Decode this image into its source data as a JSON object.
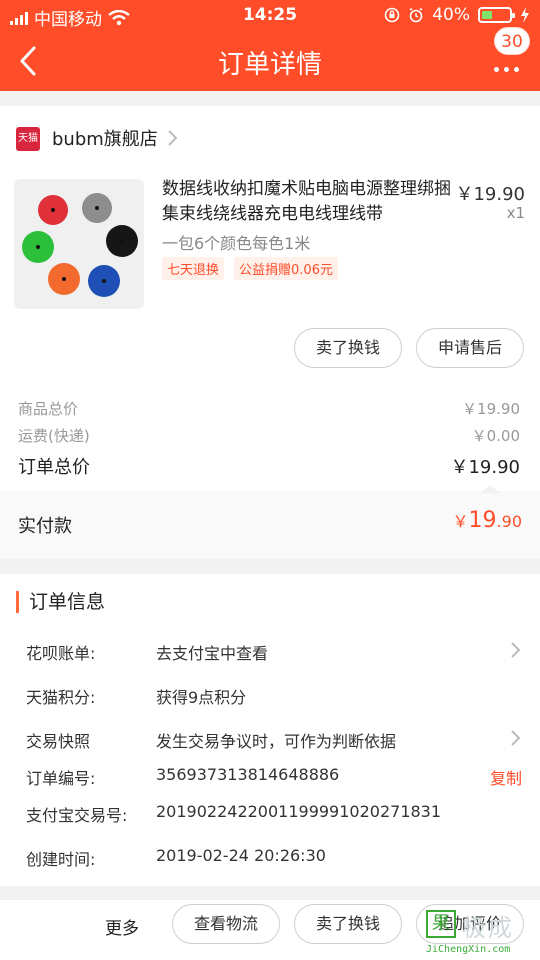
{
  "status_bar": {
    "carrier": "中国移动",
    "time": "14:25",
    "battery": "40%",
    "battery_level": 0.4
  },
  "nav": {
    "title": "订单详情",
    "badge": "30"
  },
  "shop": {
    "logo_text": "天猫",
    "name": "bubm旗舰店"
  },
  "product": {
    "title": "数据线收纳扣魔术贴电脑电源整理绑捆集束线绕线器充电电线理线带",
    "price": "￥19.90",
    "qty": "x1",
    "spec": "一包6个颜色每色1米",
    "tags": [
      "七天退换",
      "公益捐赠0.06元"
    ],
    "image_colors": [
      "#e0303a",
      "#8d8d8d",
      "#2bbf3a",
      "#161616",
      "#f26a2e",
      "#1e4fb5"
    ]
  },
  "actions": {
    "sell": "卖了换钱",
    "after_sale": "申请售后"
  },
  "prices": {
    "goods_label": "商品总价",
    "goods_value": "￥19.90",
    "shipping_label": "运费(快递)",
    "shipping_value": "￥0.00",
    "total_label": "订单总价",
    "total_value": "￥19.90",
    "paid_label": "实付款",
    "paid_currency": "￥",
    "paid_int": "19",
    "paid_dec": ".90"
  },
  "order_info": {
    "title": "订单信息",
    "rows": [
      {
        "key": "花呗账单:",
        "value": "去支付宝中查看"
      },
      {
        "key": "天猫积分:",
        "value": "获得9点积分"
      },
      {
        "key": "交易快照",
        "value": "发生交易争议时，可作为判断依据"
      },
      {
        "key": "订单编号:",
        "value": "356937313814648886"
      },
      {
        "key": "支付宝交易号:",
        "value": "2019022422001199991020271831"
      },
      {
        "key": "创建时间:",
        "value": "2019-02-24 20:26:30"
      }
    ],
    "copy": "复制"
  },
  "bottom_bar": {
    "more": "更多",
    "logistics": "查看物流",
    "sell": "卖了换钱",
    "review": "追加评价"
  },
  "watermark": {
    "box": "果",
    "cn": "极成",
    "en": "JiChengXin.com"
  },
  "colors": {
    "accent": "#ff4d2a"
  }
}
